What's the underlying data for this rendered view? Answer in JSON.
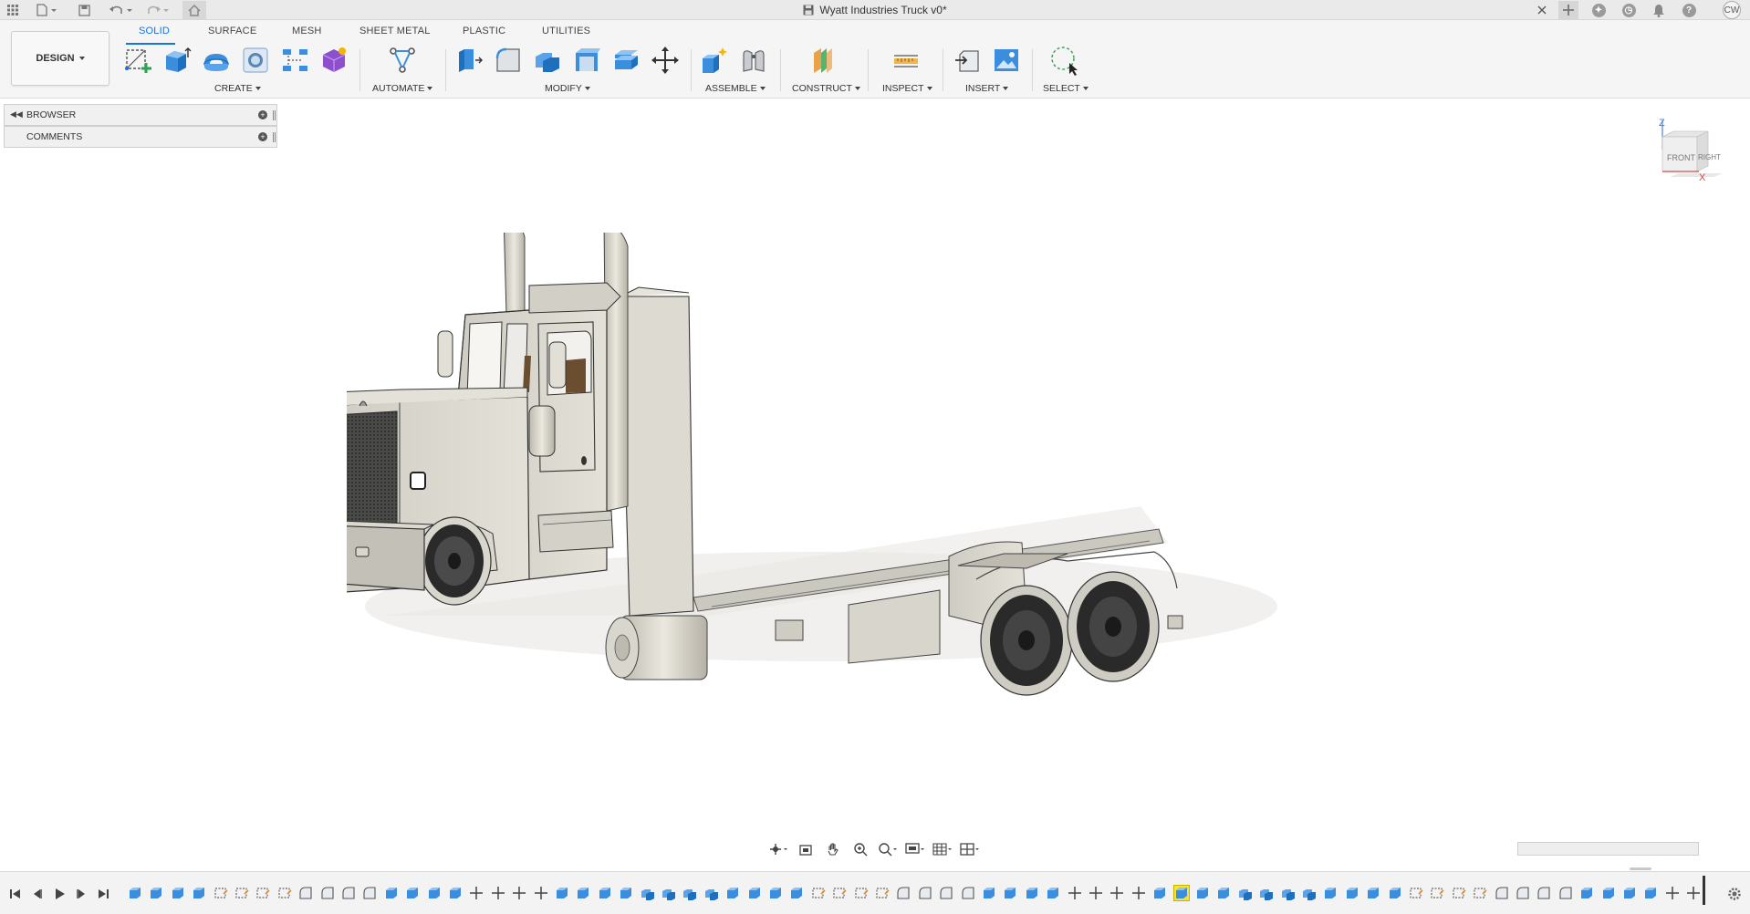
{
  "window": {
    "document_title": "Wyatt Industries Truck v0*",
    "user_initials": "CW"
  },
  "workspace": {
    "label": "DESIGN"
  },
  "tabs": [
    {
      "label": "SOLID",
      "active": true
    },
    {
      "label": "SURFACE",
      "active": false
    },
    {
      "label": "MESH",
      "active": false
    },
    {
      "label": "SHEET METAL",
      "active": false
    },
    {
      "label": "PLASTIC",
      "active": false
    },
    {
      "label": "UTILITIES",
      "active": false
    }
  ],
  "tool_groups": [
    {
      "label": "CREATE",
      "tools": [
        "new-sketch-icon",
        "extrude-icon",
        "revolve-icon",
        "hole-icon",
        "pattern-icon",
        "create-form-icon"
      ]
    },
    {
      "label": "AUTOMATE",
      "tools": [
        "automate-icon"
      ]
    },
    {
      "label": "MODIFY",
      "tools": [
        "press-pull-icon",
        "fillet-icon",
        "combine-icon",
        "shell-icon",
        "offset-face-icon",
        "move-icon"
      ]
    },
    {
      "label": "ASSEMBLE",
      "tools": [
        "new-component-icon",
        "joint-icon"
      ]
    },
    {
      "label": "CONSTRUCT",
      "tools": [
        "offset-plane-icon"
      ]
    },
    {
      "label": "INSPECT",
      "tools": [
        "measure-icon"
      ]
    },
    {
      "label": "INSERT",
      "tools": [
        "insert-derive-icon",
        "decal-icon"
      ]
    },
    {
      "label": "SELECT",
      "tools": [
        "select-window-icon"
      ]
    }
  ],
  "browser_panel": {
    "browser_label": "BROWSER",
    "comments_label": "COMMENTS"
  },
  "viewcube": {
    "front_label": "FRONT",
    "right_label": "RIGHT",
    "z_axis": "Z",
    "x_axis": "X"
  },
  "colors": {
    "accent": "#1473e6",
    "model_body": "#d8d5cc",
    "model_shadow": "#a8a59c",
    "tire": "#2a2a2a",
    "toolbar_bg": "#f5f5f5"
  },
  "navbar": {
    "icons": [
      "orbit-icon",
      "look-at-icon",
      "pan-icon",
      "zoom-icon",
      "fit-icon",
      "display-settings-icon",
      "grid-settings-icon",
      "viewports-icon"
    ]
  },
  "timeline": {
    "controls": [
      "go-to-start-icon",
      "step-back-icon",
      "play-icon",
      "step-forward-icon",
      "go-to-end-icon"
    ],
    "item_count": 74,
    "highlighted_index": 49
  }
}
